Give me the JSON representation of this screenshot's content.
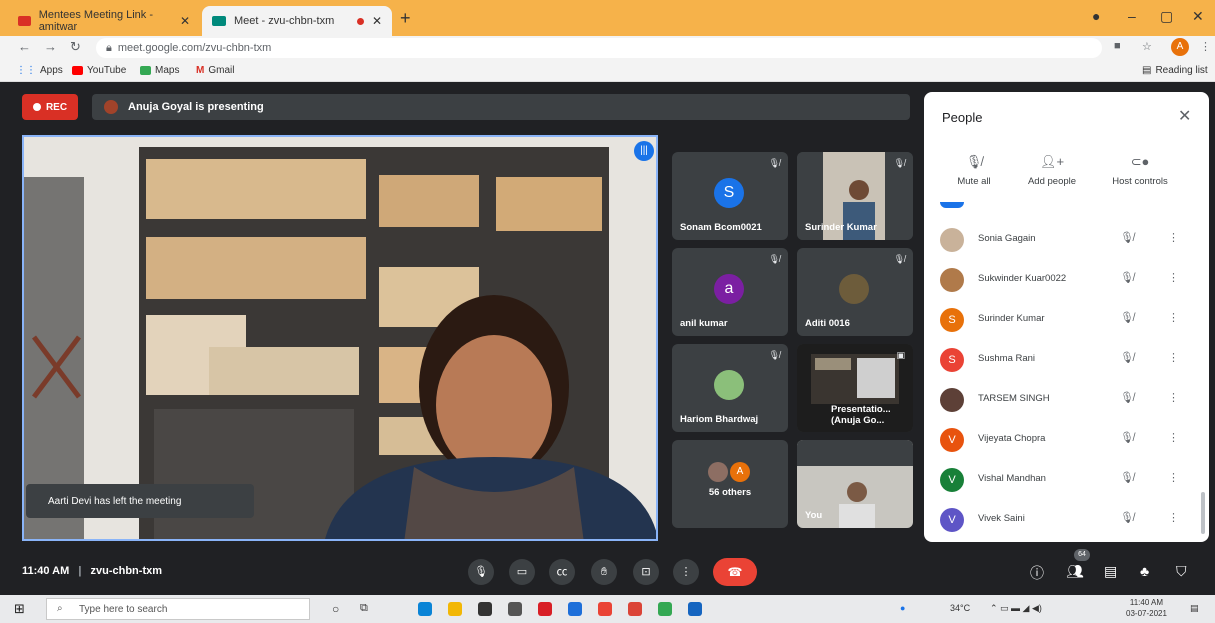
{
  "browser": {
    "tabs": [
      {
        "title": "Mentees Meeting Link - amitwar",
        "active": false
      },
      {
        "title": "Meet - zvu-chbn-txm",
        "active": true
      }
    ],
    "new_tab_icon": "plus-icon",
    "url": "meet.google.com/zvu-chbn-txm",
    "profile_initial": "A",
    "bookmarks": [
      {
        "label": "Apps"
      },
      {
        "label": "YouTube"
      },
      {
        "label": "Maps"
      },
      {
        "label": "Gmail"
      }
    ],
    "reading_list": "Reading list"
  },
  "meet": {
    "rec_label": "REC",
    "presenting_text": "Anuja Goyal is presenting",
    "toast": "Aarti Devi has left the meeting",
    "tiles": [
      {
        "name": "Sonam Bcom0021",
        "initial": "S",
        "color": "#1a73e8"
      },
      {
        "name": "Surinder Kumar"
      },
      {
        "name": "anil kumar",
        "initial": "a",
        "color": "#7b1fa2"
      },
      {
        "name": "Aditi 0016"
      },
      {
        "name": "Hariom Bhardwaj"
      },
      {
        "name": "Presentatio... (Anuja Go..."
      },
      {
        "name": "56 others",
        "initial": "A",
        "color": "#e8710a"
      },
      {
        "name": "You"
      }
    ],
    "clock": "11:40 AM",
    "meeting_code": "zvu-chbn-txm",
    "participant_count": "64"
  },
  "people_panel": {
    "title": "People",
    "actions": [
      {
        "label": "Mute all",
        "icon": "mic-off-icon"
      },
      {
        "label": "Add people",
        "icon": "add-person-icon"
      },
      {
        "label": "Host controls",
        "icon": "toggle-icon"
      }
    ],
    "participants": [
      {
        "name": "Sonia Gagain",
        "initial": "",
        "color": "#c9b29a"
      },
      {
        "name": "Sukwinder Kuar0022",
        "initial": "",
        "color": "#b07a4a"
      },
      {
        "name": "Surinder Kumar",
        "initial": "S",
        "color": "#e8710a"
      },
      {
        "name": "Sushma Rani",
        "initial": "S",
        "color": "#ea4335"
      },
      {
        "name": "TARSEM SINGH",
        "initial": "",
        "color": "#5d4037"
      },
      {
        "name": "Vijeyata Chopra",
        "initial": "V",
        "color": "#e8530e"
      },
      {
        "name": "Vishal Mandhan",
        "initial": "V",
        "color": "#188038"
      },
      {
        "name": "Vivek Saini",
        "initial": "V",
        "color": "#5e55c6"
      }
    ]
  },
  "taskbar": {
    "search_placeholder": "Type here to search",
    "weather": "34°C",
    "time": "11:40 AM",
    "date": "03-07-2021"
  }
}
